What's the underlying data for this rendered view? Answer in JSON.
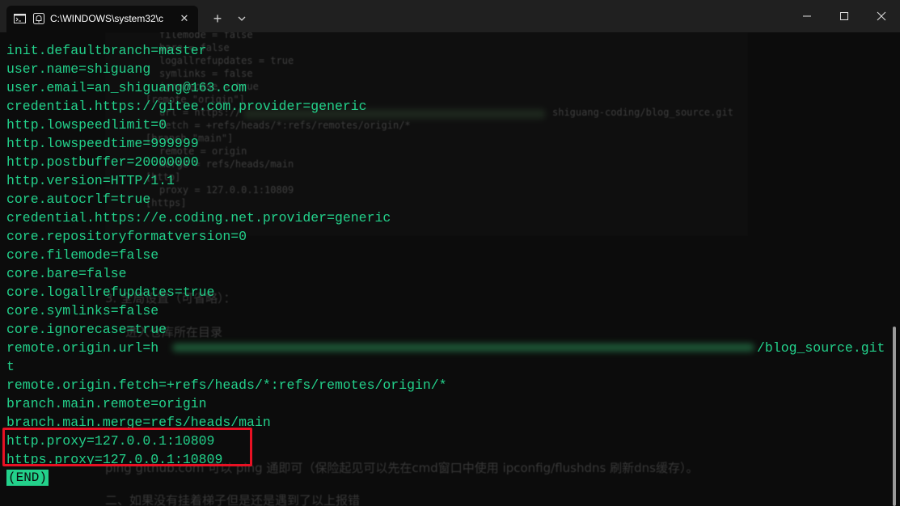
{
  "window": {
    "tab_title": "C:\\WINDOWS\\system32\\c",
    "new_tab_label": "+",
    "tab_close_label": "✕",
    "icons": {
      "tab": "terminal-icon",
      "tab_secondary": "bell-icon",
      "dropdown": "chevron-down-icon",
      "minimize": "minimize-icon",
      "maximize": "maximize-icon",
      "close": "close-icon"
    }
  },
  "terminal": {
    "lines": [
      "init.defaultbranch=master",
      "user.name=shiguang",
      "user.email=an_shiguang@163.com",
      "credential.https://gitee.com.provider=generic",
      "http.lowspeedlimit=0",
      "http.lowspeedtime=999999",
      "http.postbuffer=20000000",
      "http.version=HTTP/1.1",
      "core.autocrlf=true",
      "credential.https://e.coding.net.provider=generic",
      "core.repositoryformatversion=0",
      "core.filemode=false",
      "core.bare=false",
      "core.logallrefupdates=true",
      "core.symlinks=false",
      "core.ignorecase=true",
      "remote.origin.url=h",
      "t",
      "remote.origin.fetch=+refs/heads/*:refs/remotes/origin/*",
      "branch.main.remote=origin",
      "branch.main.merge=refs/heads/main",
      "http.proxy=127.0.0.1:10809",
      "https.proxy=127.0.0.1:10809"
    ],
    "url_tail": "/blog_source.git",
    "end_marker": "(END)"
  },
  "background": {
    "code_lines": [
      "filemode = false",
      "bare = false",
      "logallrefupdates = true",
      "symlinks = false",
      "ignorecase = true",
      "[remote \"origin\"]",
      "url = https://",
      "shiguang-coding/blog_source.git",
      "fetch = +refs/heads/*:refs/remotes/origin/*",
      "[branch \"main\"]",
      "remote = origin",
      "merge = refs/heads/main",
      "[http]",
      "proxy = 127.0.0.1:10809",
      "[https]"
    ],
    "texts": [
      "3. 全局设置（可省略）：",
      "进入仓库所在目录",
      "ping github.com 可以 ping 通即可（保险起见可以先在cmd窗口中使用 ipconfig/flushdns 刷新dns缓存）。",
      "二、如果没有挂着梯子但是还是遇到了以上报错"
    ]
  },
  "colors": {
    "terminal_text": "#23d18b",
    "highlight": "#e81123",
    "background": "#0c0c0c",
    "titlebar": "#202020"
  }
}
